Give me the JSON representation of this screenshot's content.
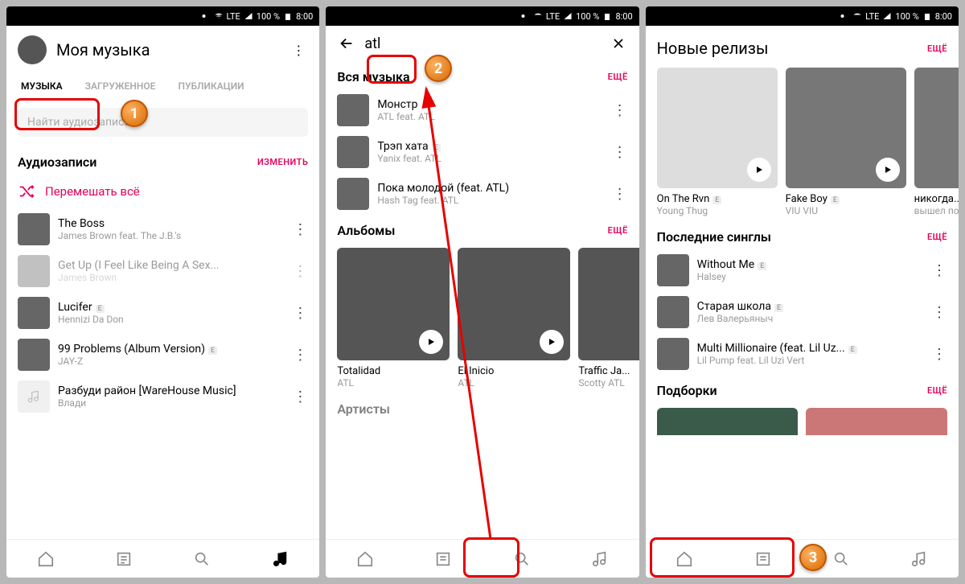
{
  "status": {
    "battery": "100 %",
    "time": "8:00",
    "net": "LTE"
  },
  "screen1": {
    "title": "Моя музыка",
    "tabs": [
      "МУЗЫКА",
      "ЗАГРУЖЕННОЕ",
      "ПУБЛИКАЦИИ"
    ],
    "search_placeholder": "Найти аудиозапись",
    "section_audio": "Аудиозаписи",
    "edit_link": "ИЗМЕНИТЬ",
    "shuffle": "Перемешать всё",
    "tracks": [
      {
        "title": "The Boss",
        "artist": "James Brown feat. The J.B.'s",
        "e": false
      },
      {
        "title": "Get Up (I Feel Like Being A Sex...",
        "artist": "James Brown",
        "e": false,
        "faded": true
      },
      {
        "title": "Lucifer",
        "artist": "Hennizi Da Don",
        "e": true
      },
      {
        "title": "99 Problems (Album Version)",
        "artist": "JAY-Z",
        "e": true
      },
      {
        "title": "Разбуди район [WareHouse Music]",
        "artist": "Влади",
        "e": false,
        "placeholder": true
      }
    ]
  },
  "screen2": {
    "search_value": "atl",
    "section_all": "Вся музыка",
    "more": "ЕЩЁ",
    "tracks": [
      {
        "title": "Монстр",
        "artist": "ATL feat. ATL"
      },
      {
        "title": "Трэп хата",
        "artist": "Yanix feat. ATL",
        "e": true
      },
      {
        "title": "Пока молодой (feat. ATL)",
        "artist": "Hash Tag feat. ATL"
      }
    ],
    "section_albums": "Альбомы",
    "albums": [
      {
        "title": "Totalidad",
        "artist": "ATL"
      },
      {
        "title": "El Inicio",
        "artist": "ATL"
      },
      {
        "title": "Traffic Ja...",
        "artist": "Scotty ATL"
      }
    ],
    "section_artists": "Артисты"
  },
  "screen3": {
    "section_new": "Новые релизы",
    "more": "ЕЩЁ",
    "releases": [
      {
        "title": "On The Rvn",
        "artist": "Young Thug",
        "e": true
      },
      {
        "title": "Fake Boy",
        "artist": "VIU VIU",
        "e": true
      },
      {
        "title": "никогда...",
        "artist": "вышел по..."
      }
    ],
    "section_singles": "Последние синглы",
    "singles": [
      {
        "title": "Without Me",
        "artist": "Halsey",
        "e": true
      },
      {
        "title": "Старая школа",
        "artist": "Лев Валерьяныч",
        "e": true
      },
      {
        "title": "Multi Millionaire (feat. Lil Uz...",
        "artist": "Lil Pump feat. Lil Uzi Vert",
        "e": true
      }
    ],
    "section_collections": "Подборки"
  },
  "callouts": {
    "c1": "1",
    "c2": "2",
    "c3": "3"
  }
}
